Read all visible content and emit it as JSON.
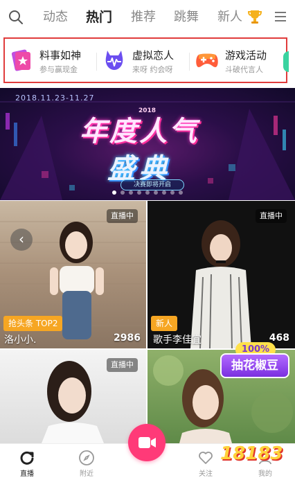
{
  "nav": {
    "tabs": [
      {
        "label": "动态",
        "active": false
      },
      {
        "label": "热门",
        "active": true
      },
      {
        "label": "推荐",
        "active": false
      },
      {
        "label": "跳舞",
        "active": false
      },
      {
        "label": "新人",
        "active": false
      }
    ],
    "icons": [
      "search-icon",
      "trophy-icon",
      "menu-icon"
    ]
  },
  "shortcuts": [
    {
      "title": "料事如神",
      "subtitle": "参与赢现金",
      "icon": "star-card-icon",
      "color": "#e63fb8"
    },
    {
      "title": "虚拟恋人",
      "subtitle": "来呀 约会呀",
      "icon": "heart-wave-icon",
      "color": "#7a5cf0"
    },
    {
      "title": "游戏活动",
      "subtitle": "斗破代言人",
      "icon": "gamepad-icon",
      "color": "#ff6a3d"
    }
  ],
  "banner": {
    "date": "2018.11.23-11.27",
    "year": "2018",
    "title_line1": "年度人气",
    "title_line2": "盛典",
    "pill": "决赛即将开启",
    "dot_count": 9,
    "active_dot": 0
  },
  "streams": [
    {
      "live": "直播中",
      "tag": "抢头条 TOP2",
      "name": "洛小小.",
      "count": "2986"
    },
    {
      "live": "直播中",
      "tag": "新人",
      "name": "歌手李佳宜",
      "count": "468"
    },
    {
      "live": "直播中",
      "tag": "",
      "name": "",
      "count": ""
    },
    {
      "live": "",
      "tag": "",
      "name": "",
      "count": ""
    }
  ],
  "promo": {
    "badge": "100%",
    "label": "抽花椒豆"
  },
  "bottom": {
    "items": [
      {
        "label": "直播",
        "icon": "refresh-icon",
        "active": true
      },
      {
        "label": "附近",
        "icon": "compass-icon",
        "active": false
      },
      {
        "label": "",
        "icon": "camera-icon",
        "active": false
      },
      {
        "label": "关注",
        "icon": "heart-icon",
        "active": false
      },
      {
        "label": "我的",
        "icon": "profile-icon",
        "active": false
      }
    ]
  },
  "watermark": "18183",
  "colors": {
    "accent": "#ff3a78",
    "outline": "#e03b3b",
    "tag": "#f6a623"
  }
}
